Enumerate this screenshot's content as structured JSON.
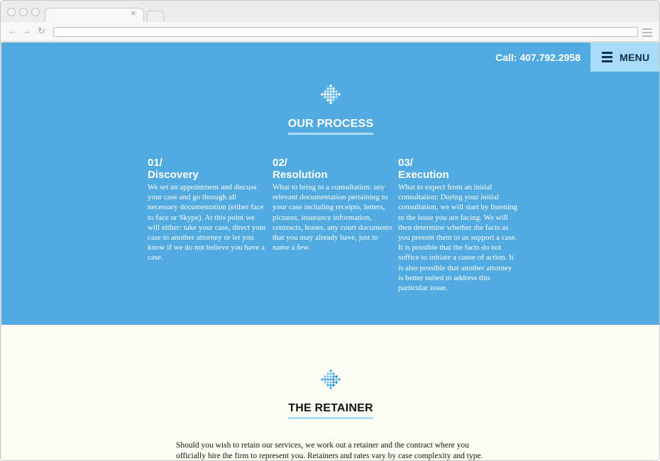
{
  "browser": {
    "tab_close_icon": "close-icon",
    "back_icon": "arrow-left-icon",
    "forward_icon": "arrow-right-icon",
    "reload_icon": "reload-icon",
    "url": ""
  },
  "header": {
    "phone": "Call: 407.792.2958",
    "menu_label": "MENU"
  },
  "process": {
    "title": "OUR PROCESS",
    "steps": [
      {
        "number": "01/",
        "name": "Discovery",
        "text": "We set an appointment and discuss your case and go through all necessary documentation (either face to face or Skype).  At this point we will either: take your case, direct your case to another attorney or let you know if we do not believe you have a case."
      },
      {
        "number": "02/",
        "name": "Resolution",
        "text": "What to bring to a consultation: any relevant documentation pertaining to your case including receipts, letters, pictures, insurance information, contracts, leases, any court documents that you may already have, just to name a few."
      },
      {
        "number": "03/",
        "name": "Execution",
        "text": "What to expect from an initial consultation:  During your initial consultation, we will start by listening to the issue you are facing.  We will then determine whether the facts as you present them to us support a case. It is possible that the facts do not suffice to initiate a cause of action. It is also possible that another attorney is better suited to address this particular issue."
      }
    ]
  },
  "retainer": {
    "title": "THE RETAINER",
    "text": "Should you wish to retain our services, we work out a retainer and the contract where you officially hire the firm to represent you.  Retainers and rates vary by case complexity and type."
  },
  "colors": {
    "process_bg": "#52abe0",
    "menu_bg": "#a7dbf7",
    "menu_text": "#0d2f4a",
    "retainer_bg": "#fdfdf3",
    "accent_underline": "#a7dbf7"
  }
}
